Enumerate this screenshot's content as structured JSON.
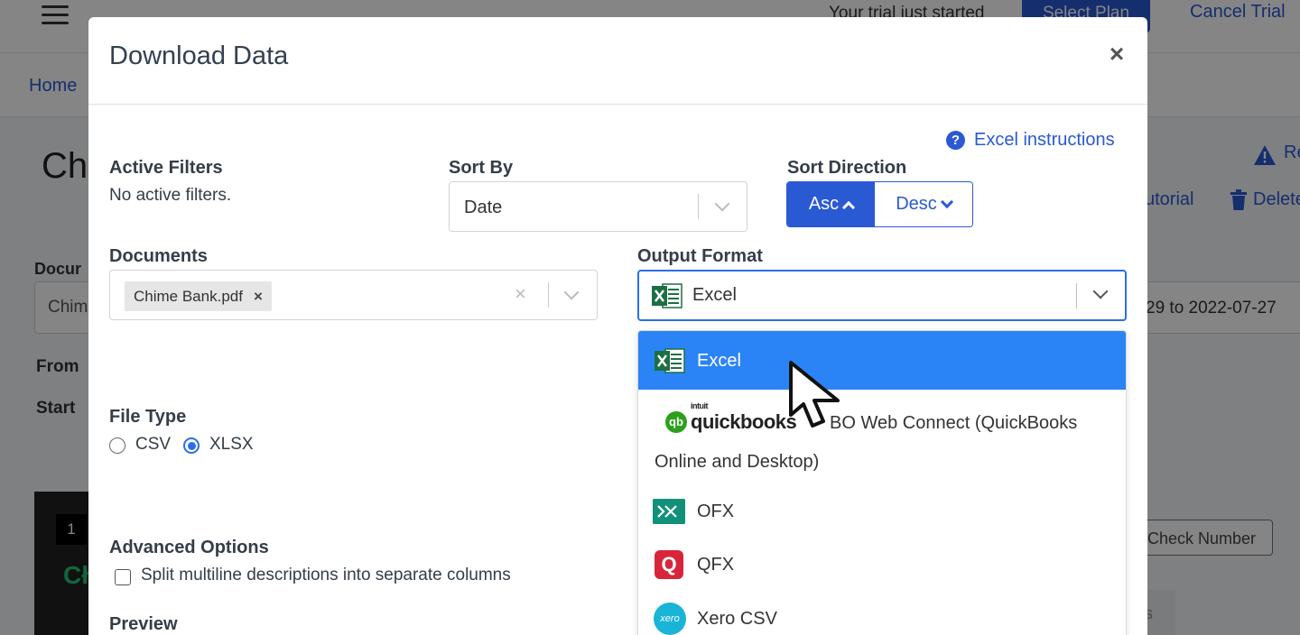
{
  "background": {
    "trial_text": "Your trial just started",
    "select_plan": "Select Plan",
    "cancel_trial": "Cancel Trial",
    "breadcrumb_home": "Home",
    "page_title_partial": "Ch",
    "documents_label_partial": "Docur",
    "documents_value_partial": "Chim",
    "from_label_partial": "From",
    "start_label_partial": "Start",
    "page_number": "1",
    "brand_partial": "Cł",
    "report_partial": "Re",
    "tutorial_partial": "utorial",
    "delete_partial": "Delete",
    "date_range_partial": "29 to 2022-07-27",
    "check_number_button": "Check Number",
    "small_tab_partial": "s"
  },
  "modal": {
    "title": "Download Data",
    "close_glyph": "×",
    "help_link": "Excel instructions",
    "help_glyph": "?",
    "active_filters": {
      "label": "Active Filters",
      "value": "No active filters."
    },
    "sort_by": {
      "label": "Sort By",
      "value": "Date"
    },
    "sort_direction": {
      "label": "Sort Direction",
      "asc": "Asc",
      "desc": "Desc",
      "selected": "Asc"
    },
    "documents": {
      "label": "Documents",
      "tags": [
        "Chime Bank.pdf"
      ],
      "tag_remove_glyph": "×",
      "clear_glyph": "×"
    },
    "output_format": {
      "label": "Output Format",
      "value": "Excel",
      "options": [
        {
          "label": "Excel",
          "icon": "excel-icon",
          "selected": true
        },
        {
          "label": "BO Web Connect (QuickBooks",
          "label_line2": "Online and Desktop)",
          "icon": "quickbooks-logo",
          "logo_brand": "intuit",
          "logo_word": "quickbooks",
          "logo_mark": "qb"
        },
        {
          "label": "OFX",
          "icon": "ofx-icon"
        },
        {
          "label": "QFX",
          "icon": "qfx-icon",
          "icon_glyph": "Q"
        },
        {
          "label": "Xero CSV",
          "icon": "xero-icon",
          "icon_glyph": "xero"
        }
      ]
    },
    "file_type": {
      "label": "File Type",
      "options": [
        "CSV",
        "XLSX"
      ],
      "selected": "XLSX"
    },
    "advanced_options": {
      "label": "Advanced Options",
      "split_multiline": "Split multiline descriptions into separate columns",
      "split_multiline_checked": false
    },
    "preview": {
      "label": "Preview"
    }
  },
  "colors": {
    "primary": "#2a59d4",
    "selected_option": "#2b84f6",
    "excel_green": "#1d6f42",
    "quickbooks_green": "#2ca01c",
    "ofx_teal": "#12917a",
    "qfx_red": "#d8253b",
    "xero_blue": "#1ab4d7"
  }
}
